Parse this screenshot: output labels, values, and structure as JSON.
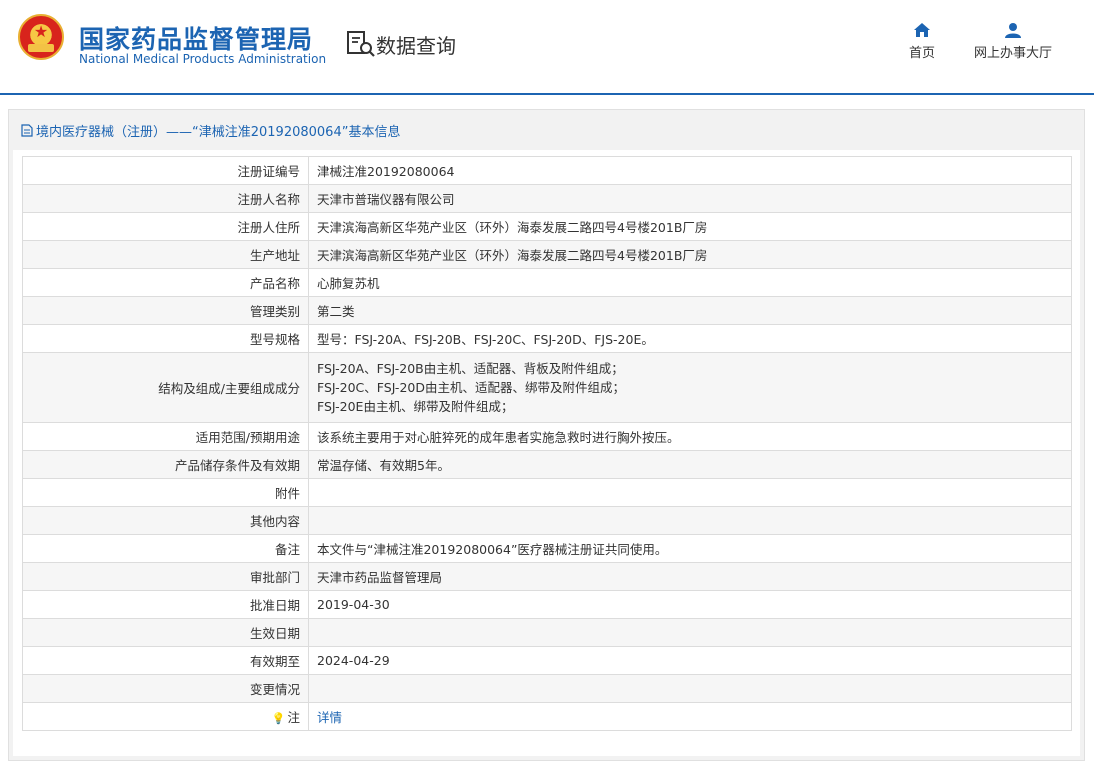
{
  "header": {
    "org_name_cn": "国家药品监督管理局",
    "org_name_en": "National Medical Products Administration",
    "section_title": "数据查询",
    "nav": [
      {
        "label": "首页",
        "icon": "home-icon"
      },
      {
        "label": "网上办事大厅",
        "icon": "user-icon"
      }
    ],
    "colors": {
      "brand": "#1c64b2",
      "emblem_red": "#d8241c",
      "emblem_gold": "#f3c245"
    }
  },
  "panel": {
    "title": "境内医疗器械（注册）——“津械注准20192080064”基本信息"
  },
  "record": {
    "rows": [
      {
        "label": "注册证编号",
        "value": "津械注准20192080064"
      },
      {
        "label": "注册人名称",
        "value": "天津市普瑞仪器有限公司"
      },
      {
        "label": "注册人住所",
        "value": "天津滨海高新区华苑产业区（环外）海泰发展二路四号4号楼201B厂房"
      },
      {
        "label": "生产地址",
        "value": "天津滨海高新区华苑产业区（环外）海泰发展二路四号4号楼201B厂房"
      },
      {
        "label": "产品名称",
        "value": "心肺复苏机"
      },
      {
        "label": "管理类别",
        "value": "第二类"
      },
      {
        "label": "型号规格",
        "value": "型号：FSJ-20A、FSJ-20B、FSJ-20C、FSJ-20D、FJS-20E。"
      },
      {
        "label": "结构及组成/主要组成成分",
        "lines": [
          "FSJ-20A、FSJ-20B由主机、适配器、背板及附件组成；",
          "FSJ-20C、FSJ-20D由主机、适配器、绑带及附件组成；",
          "FSJ-20E由主机、绑带及附件组成；"
        ]
      },
      {
        "label": "适用范围/预期用途",
        "value": "该系统主要用于对心脏猝死的成年患者实施急救时进行胸外按压。"
      },
      {
        "label": "产品储存条件及有效期",
        "value": "常温存储、有效期5年。"
      },
      {
        "label": "附件",
        "value": ""
      },
      {
        "label": "其他内容",
        "value": ""
      },
      {
        "label": "备注",
        "value": "本文件与“津械注准20192080064”医疗器械注册证共同使用。"
      },
      {
        "label": "审批部门",
        "value": "天津市药品监督管理局"
      },
      {
        "label": "批准日期",
        "value": "2019-04-30"
      },
      {
        "label": "生效日期",
        "value": ""
      },
      {
        "label": "有效期至",
        "value": "2024-04-29"
      },
      {
        "label": "变更情况",
        "value": ""
      },
      {
        "label": "注",
        "value": "详情",
        "icon": "lightbulb-icon"
      }
    ]
  }
}
